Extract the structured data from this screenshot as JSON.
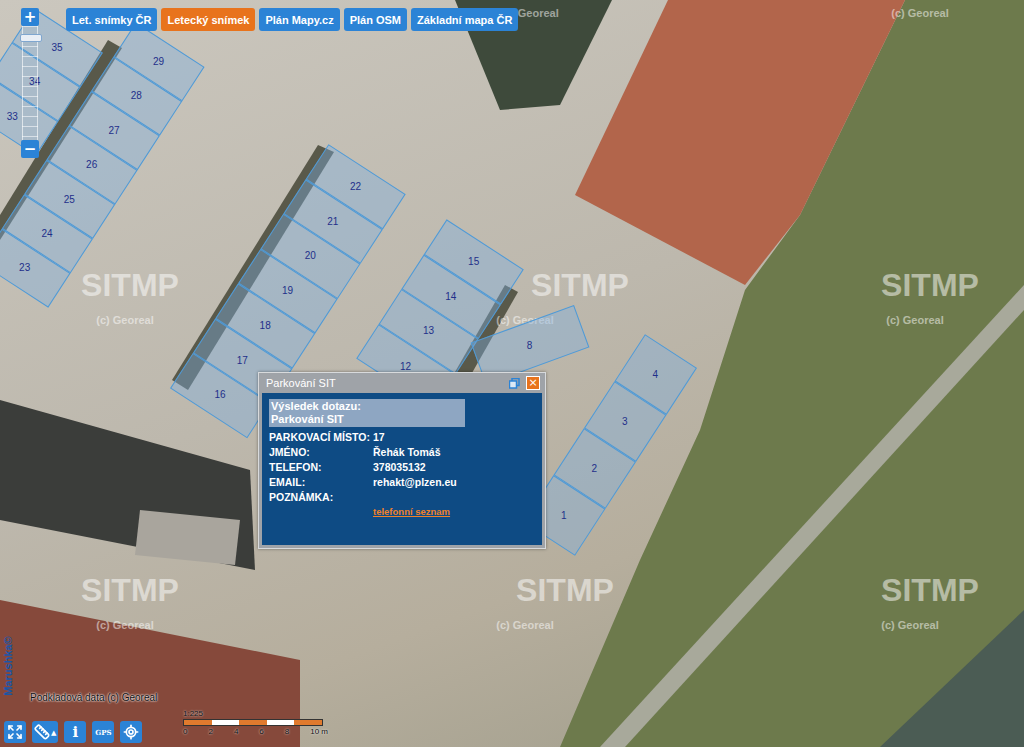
{
  "layers": [
    {
      "label": "Let. snímky ČR",
      "selected": false
    },
    {
      "label": "Letecký snímek",
      "selected": true
    },
    {
      "label": "Plán Mapy.cz",
      "selected": false
    },
    {
      "label": "Plán OSM",
      "selected": false
    },
    {
      "label": "Základní mapa ČR",
      "selected": false
    }
  ],
  "zoom": {
    "in": "+",
    "out": "−",
    "level": 0.9
  },
  "spot_rows": [
    {
      "spots": [
        "33",
        "34",
        "35"
      ]
    },
    {
      "spots": [
        "23",
        "24",
        "25",
        "26",
        "27",
        "28",
        "29"
      ]
    },
    {
      "spots": [
        "16",
        "17",
        "18",
        "19",
        "20",
        "21",
        "22"
      ]
    },
    {
      "spots": [
        "12",
        "13",
        "14",
        "15"
      ]
    },
    {
      "spots": [
        "8"
      ]
    },
    {
      "spots": [
        "1",
        "2",
        "3",
        "4"
      ]
    }
  ],
  "watermarks": {
    "logo": "SITMP",
    "copyright": "(c) Georeal"
  },
  "popup": {
    "title": "Parkování SIT",
    "close": "×",
    "heading": [
      "Výsledek dotazu:",
      "Parkování SIT"
    ],
    "fields": [
      {
        "label": "PARKOVACÍ MÍSTO:",
        "value": "17"
      },
      {
        "label": "JMÉNO:",
        "value": "Řehák Tomáš"
      },
      {
        "label": "TELEFON:",
        "value": "378035132"
      },
      {
        "label": "EMAIL:",
        "value": "rehakt@plzen.eu"
      },
      {
        "label": "POZNÁMKA:",
        "value": ""
      }
    ],
    "link": "telefonní seznam"
  },
  "brand": "Marushka©",
  "attribution": "Podkladová data (c) Georeal",
  "scale": {
    "ratio": "1:225",
    "ticks": [
      "0",
      "2",
      "4",
      "6",
      "8",
      "10 m"
    ]
  },
  "tools": [
    {
      "kind": "fullscreen",
      "text": ""
    },
    {
      "kind": "measure",
      "text": "▲"
    },
    {
      "kind": "info",
      "text": "i"
    },
    {
      "kind": "gps",
      "text": "GPS"
    },
    {
      "kind": "locate",
      "text": ""
    }
  ]
}
